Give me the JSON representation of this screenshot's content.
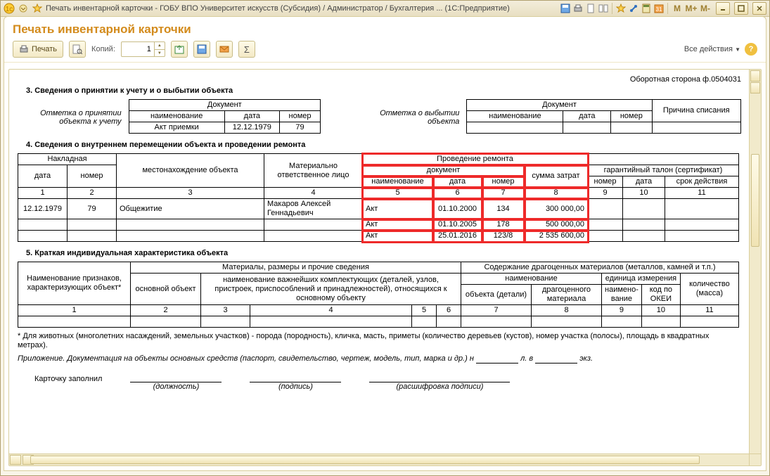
{
  "titlebar": {
    "text": "Печать инвентарной карточки - ГОБУ ВПО Университет искусств (Субсидия) / Администратор / Бухгалтерия ... (1С:Предприятие)",
    "letters": [
      "M",
      "M+",
      "M-"
    ]
  },
  "page_title": "Печать инвентарной карточки",
  "toolbar": {
    "print_label": "Печать",
    "copies_label": "Копий:",
    "copies_value": "1",
    "all_actions": "Все действия"
  },
  "doc": {
    "side_note": "Оборотная сторона ф.0504031",
    "sec3": {
      "title": "3. Сведения о принятии к учету и о выбытии объекта",
      "left_caption_1": "Отметка о принятии",
      "left_caption_2": "объекта к учету",
      "right_caption_1": "Отметка о выбытии",
      "right_caption_2": "объекта",
      "doc_header": "Документ",
      "cols": {
        "name": "наименование",
        "date": "дата",
        "number": "номер"
      },
      "accept": {
        "name": "Акт приемки",
        "date": "12.12.1979",
        "number": "79"
      },
      "reason_header": "Причина списания"
    },
    "sec4": {
      "title": "4. Сведения о внутреннем перемещении объекта и проведении ремонта",
      "cols": {
        "waybill": "Накладная",
        "date": "дата",
        "number": "номер",
        "location": "местонахождение объекта",
        "resp": "Материально ответственное лицо",
        "repair": "Проведение ремонта",
        "doc": "документ",
        "doc_name": "наименование",
        "doc_date": "дата",
        "doc_number": "номер",
        "sum": "сумма затрат",
        "warranty": "гарантийный талон (сертификат)",
        "w_number": "номер",
        "w_date": "дата",
        "w_term": "срок действия"
      },
      "nums": [
        "1",
        "2",
        "3",
        "4",
        "5",
        "6",
        "7",
        "8",
        "9",
        "10",
        "11"
      ],
      "move": {
        "date": "12.12.1979",
        "number": "79",
        "location": "Общежитие",
        "resp": "Макаров Алексей Геннадьевич"
      },
      "repairs": [
        {
          "name": "Акт",
          "date": "01.10.2000",
          "number": "134",
          "sum": "300 000,00"
        },
        {
          "name": "Акт",
          "date": "01.10.2005",
          "number": "178",
          "sum": "500 000,00"
        },
        {
          "name": "Акт",
          "date": "25.01.2016",
          "number": "123/8",
          "sum": "2 535 600,00"
        }
      ]
    },
    "sec5": {
      "title": "5. Краткая индивидуальная характеристика объекта",
      "cols": {
        "attrs": "Наименование признаков, характеризующих объект*",
        "mat": "Материалы, размеры и прочие сведения",
        "main": "основной объект",
        "parts": "наименование важнейших комплектующих (деталей, узлов, пристроек, приспособлений и принадлежностей), относящихся к основному объекту",
        "precious": "Содержание драгоценных материалов (металлов, камней и т.п.)",
        "p_name": "наименование",
        "p_obj": "объекта (детали)",
        "p_mat": "драгоценного материала",
        "unit": "единица измерения",
        "u_name": "наимено- вание",
        "u_code": "код по ОКЕИ",
        "qty": "количество (масса)"
      },
      "nums": [
        "1",
        "2",
        "3",
        "4",
        "5",
        "6",
        "7",
        "8",
        "9",
        "10",
        "11"
      ]
    },
    "foot": {
      "note1": "* Для животных (многолетних насаждений, земельных участков) - порода (породность), кличка, масть, приметы (количество деревьев (кустов), номер участка (полосы), площадь в квадратных метрах).",
      "note2a": "Приложение. Документация на объекты основных средств (паспорт, свидетельство, чертеж, модель, тип, марка и др.) н",
      "note2b": "л. в",
      "note2c": "экз.",
      "sign_label": "Карточку заполнил",
      "sign_cols": {
        "pos": "(должность)",
        "sig": "(подпись)",
        "name": "(расшифровка подписи)"
      }
    }
  }
}
